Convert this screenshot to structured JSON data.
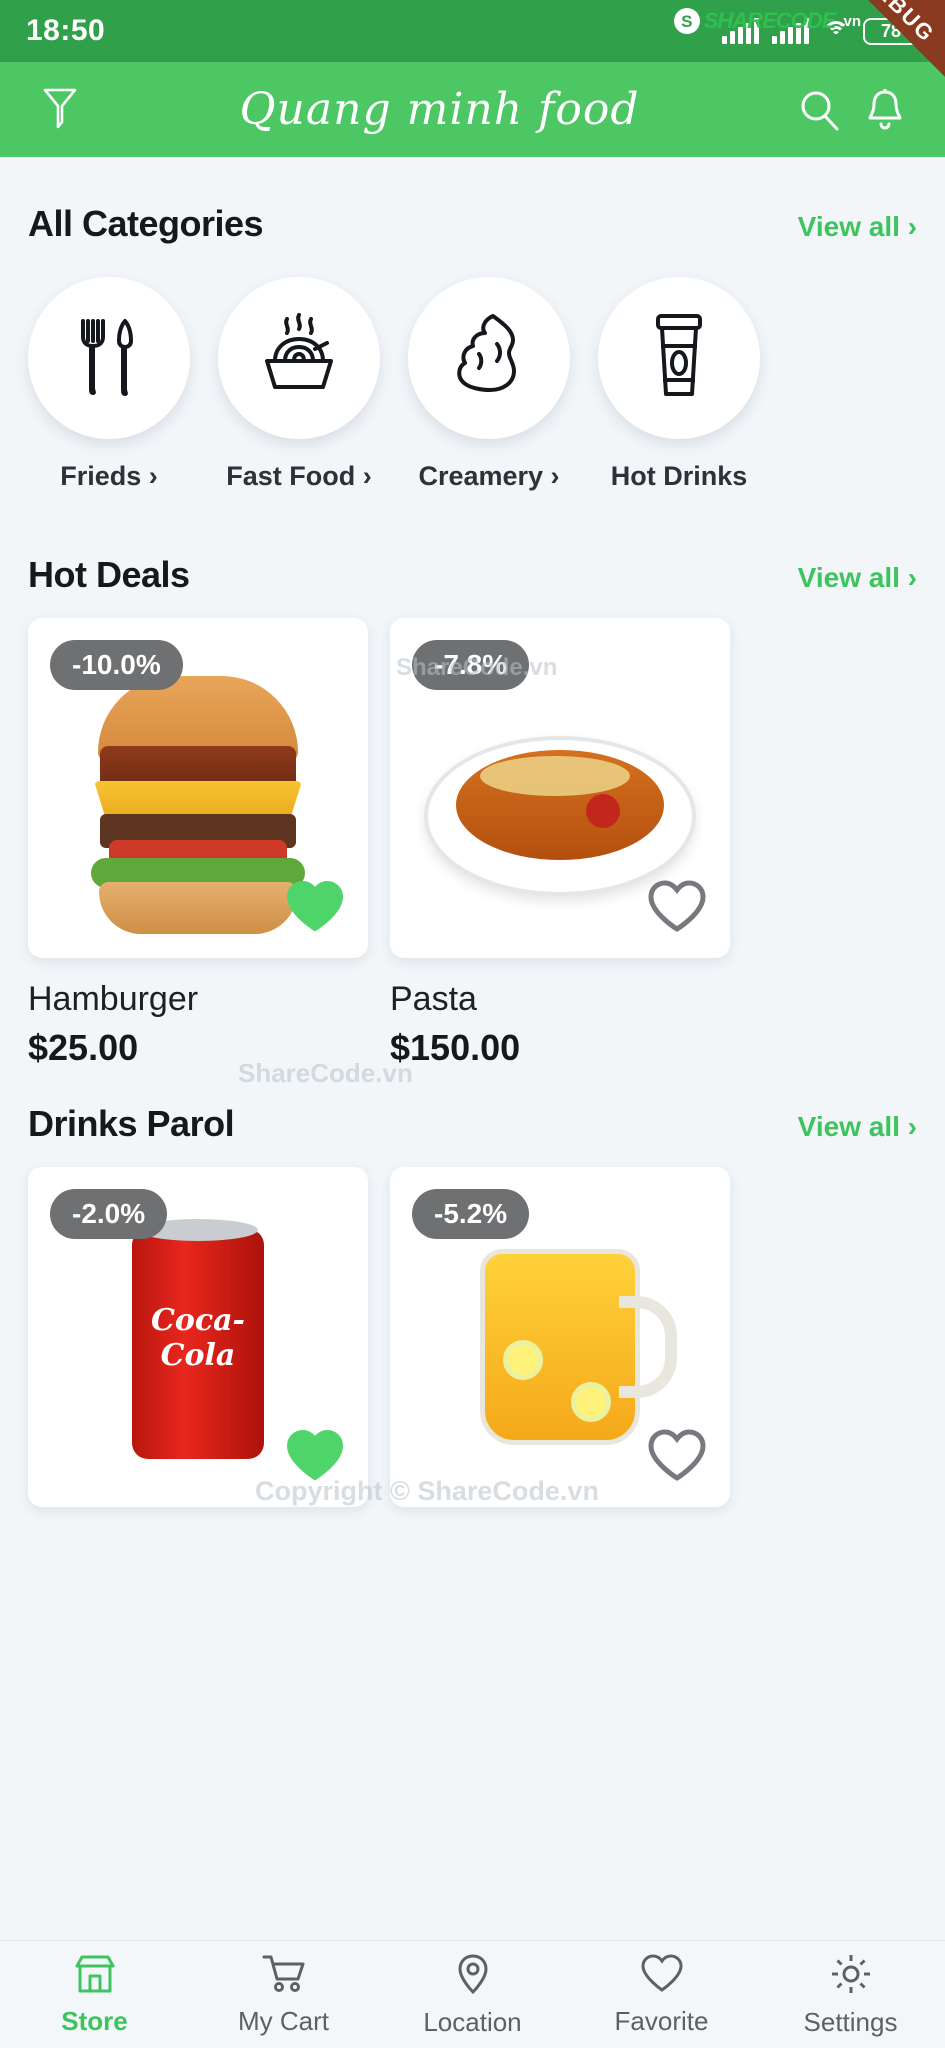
{
  "statusbar": {
    "time": "18:50",
    "battery": "78",
    "signal_icon": "signal-bars-icon",
    "wifi_icon": "wifi-icon",
    "debug_ribbon": "DEBUG",
    "watermark_brand": "SHARECODE",
    "watermark_tld": ".vn",
    "watermark_logo": "S"
  },
  "appbar": {
    "title": "Quang minh food",
    "filter_icon": "filter-funnel-icon",
    "search_icon": "search-icon",
    "bell_icon": "notification-bell-icon"
  },
  "categories_section": {
    "title": "All Categories",
    "view_all": "View all ›",
    "items": [
      {
        "label": "Frieds ›",
        "icon": "fork-knife-icon"
      },
      {
        "label": "Fast Food ›",
        "icon": "noodle-bowl-icon"
      },
      {
        "label": "Creamery ›",
        "icon": "ice-cream-swirl-icon"
      },
      {
        "label": "Hot Drinks",
        "icon": "coffee-cup-icon"
      }
    ]
  },
  "hot_deals": {
    "title": "Hot Deals",
    "view_all": "View all ›",
    "items": [
      {
        "discount": "-10.0%",
        "name": "Hamburger",
        "price": "$25.00",
        "favorite": true,
        "image": "hamburger-image"
      },
      {
        "discount": "-7.8%",
        "name": "Pasta",
        "price": "$150.00",
        "favorite": false,
        "image": "pasta-image"
      }
    ]
  },
  "drinks_parol": {
    "title": "Drinks Parol",
    "view_all": "View all ›",
    "items": [
      {
        "discount": "-2.0%",
        "name": "Coca Cola",
        "price": "",
        "favorite": true,
        "image": "coke-can-image",
        "can_text": "Coca-Cola"
      },
      {
        "discount": "-5.2%",
        "name": "Juice",
        "price": "",
        "favorite": false,
        "image": "juice-pitcher-image"
      }
    ]
  },
  "watermarks": {
    "mid_pasta": "ShareCode.vn",
    "mid_center": "ShareCode.vn",
    "footer": "Copyright © ShareCode.vn"
  },
  "bottomnav": {
    "items": [
      {
        "label": "Store",
        "icon": "store-icon",
        "active": true
      },
      {
        "label": "My Cart",
        "icon": "cart-icon",
        "active": false
      },
      {
        "label": "Location",
        "icon": "location-pin-icon",
        "active": false
      },
      {
        "label": "Favorite",
        "icon": "heart-icon",
        "active": false
      },
      {
        "label": "Settings",
        "icon": "gear-icon",
        "active": false
      }
    ]
  },
  "colors": {
    "status_green": "#30a04a",
    "app_green": "#4cc764",
    "accent_green": "#3ec45f",
    "badge_gray": "#6f7072",
    "page_bg": "#f2f6f9"
  }
}
